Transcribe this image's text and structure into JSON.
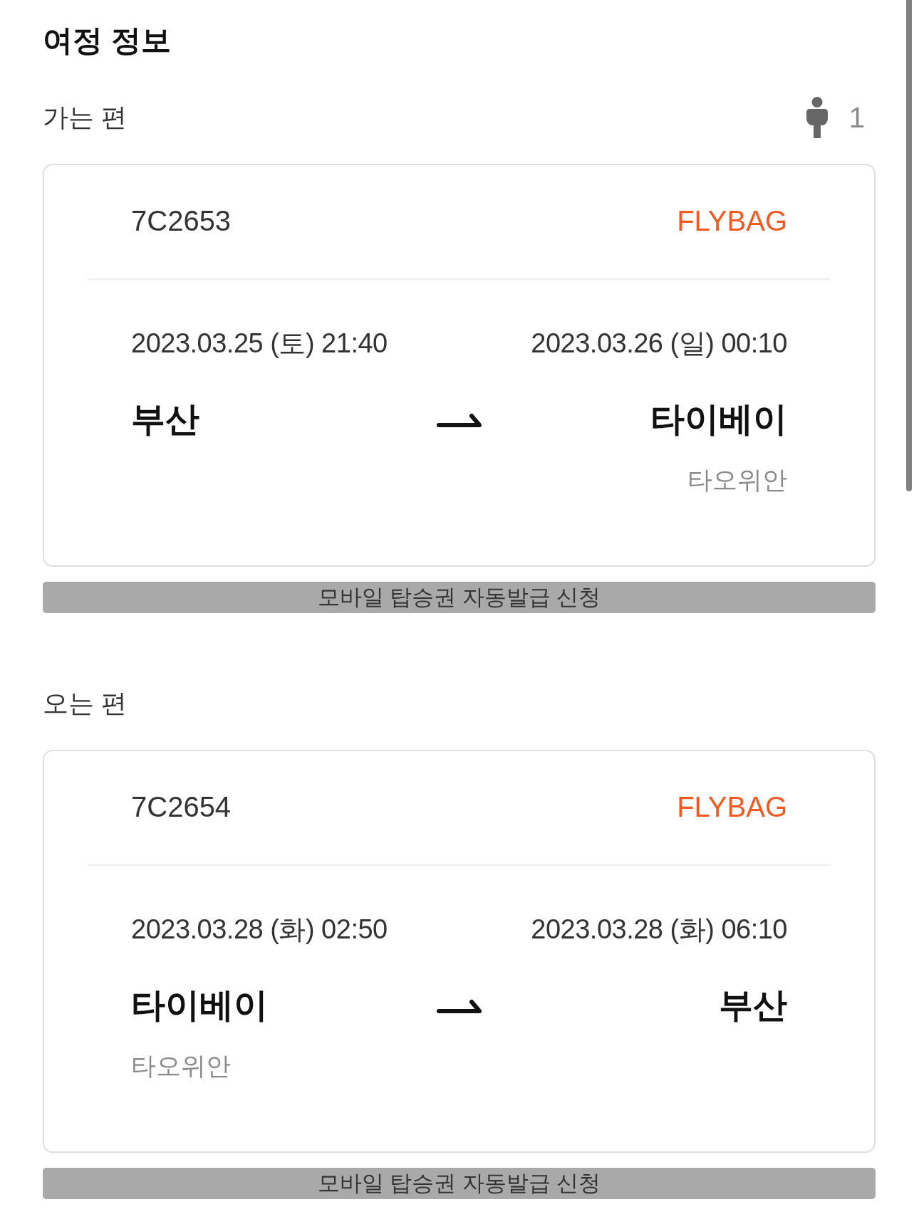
{
  "title": "여정 정보",
  "legs": [
    {
      "label": "가는 편",
      "passenger_count": "1",
      "flight_number": "7C2653",
      "fare": "FLYBAG",
      "departure": {
        "datetime": "2023.03.25 (토) 21:40",
        "city": "부산"
      },
      "arrival": {
        "datetime": "2023.03.26 (일) 00:10",
        "city": "타이베이",
        "airport": "타오위안"
      },
      "button": "모바일 탑승권 자동발급 신청"
    },
    {
      "label": "오는 편",
      "flight_number": "7C2654",
      "fare": "FLYBAG",
      "departure": {
        "datetime": "2023.03.28 (화) 02:50",
        "city": "타이베이",
        "airport": "타오위안"
      },
      "arrival": {
        "datetime": "2023.03.28 (화) 06:10",
        "city": "부산"
      },
      "button": "모바일 탑승권 자동발급 신청"
    }
  ]
}
